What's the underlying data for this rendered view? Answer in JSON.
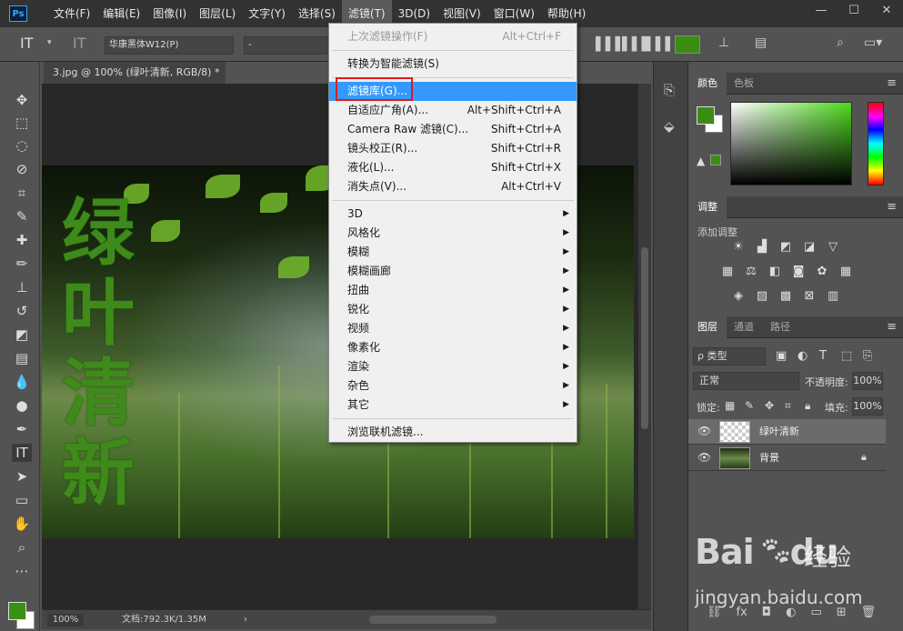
{
  "app": {
    "logo": "Ps"
  },
  "menubar": {
    "items": [
      "文件(F)",
      "编辑(E)",
      "图像(I)",
      "图层(L)",
      "文字(Y)",
      "选择(S)",
      "滤镜(T)",
      "3D(D)",
      "视图(V)",
      "窗口(W)",
      "帮助(H)"
    ],
    "active_index": 6,
    "window_buttons": [
      "—",
      "☐",
      "✕"
    ]
  },
  "options": {
    "font_family": "华康黑体W12(P)",
    "font_style": "-"
  },
  "document": {
    "tab_title": "3.jpg @ 100% (绿叶清新, RGB/8) *",
    "overlay_text": "绿叶清新",
    "zoom": "100%",
    "doc_info": "文档:792.3K/1.35M"
  },
  "panels": {
    "color": {
      "tabs": [
        "颜色",
        "色板"
      ],
      "fg": "#3c8c12",
      "bg": "#ffffff"
    },
    "adjustments": {
      "tab": "调整",
      "add_label": "添加调整"
    },
    "layers": {
      "tabs": [
        "图层",
        "通道",
        "路径"
      ],
      "type_filter": "ρ 类型",
      "blend_mode": "正常",
      "opacity_label": "不透明度:",
      "opacity_value": "100%",
      "lock_label": "锁定:",
      "fill_label": "填充:",
      "fill_value": "100%",
      "rows": [
        {
          "name": "绿叶清新",
          "selected": true
        },
        {
          "name": "背景",
          "selected": false,
          "locked": true
        }
      ]
    }
  },
  "filter_menu": {
    "items": [
      {
        "label": "上次滤镜操作(F)",
        "shortcut": "Alt+Ctrl+F",
        "disabled": true
      },
      {
        "separator": true
      },
      {
        "label": "转换为智能滤镜(S)"
      },
      {
        "separator": true
      },
      {
        "label": "滤镜库(G)...",
        "highlight": true
      },
      {
        "label": "自适应广角(A)...",
        "shortcut": "Alt+Shift+Ctrl+A"
      },
      {
        "label": "Camera Raw 滤镜(C)...",
        "shortcut": "Shift+Ctrl+A"
      },
      {
        "label": "镜头校正(R)...",
        "shortcut": "Shift+Ctrl+R"
      },
      {
        "label": "液化(L)...",
        "shortcut": "Shift+Ctrl+X"
      },
      {
        "label": "消失点(V)...",
        "shortcut": "Alt+Ctrl+V"
      },
      {
        "separator": true
      },
      {
        "label": "3D",
        "submenu": true
      },
      {
        "label": "风格化",
        "submenu": true
      },
      {
        "label": "模糊",
        "submenu": true
      },
      {
        "label": "模糊画廊",
        "submenu": true
      },
      {
        "label": "扭曲",
        "submenu": true
      },
      {
        "label": "锐化",
        "submenu": true
      },
      {
        "label": "视频",
        "submenu": true
      },
      {
        "label": "像素化",
        "submenu": true
      },
      {
        "label": "渲染",
        "submenu": true
      },
      {
        "label": "杂色",
        "submenu": true
      },
      {
        "label": "其它",
        "submenu": true
      },
      {
        "separator": true
      },
      {
        "label": "浏览联机滤镜..."
      }
    ]
  },
  "watermark": {
    "logo_prefix": "Bai",
    "logo_suffix": "du",
    "cn": "经验",
    "url": "jingyan.baidu.com"
  }
}
